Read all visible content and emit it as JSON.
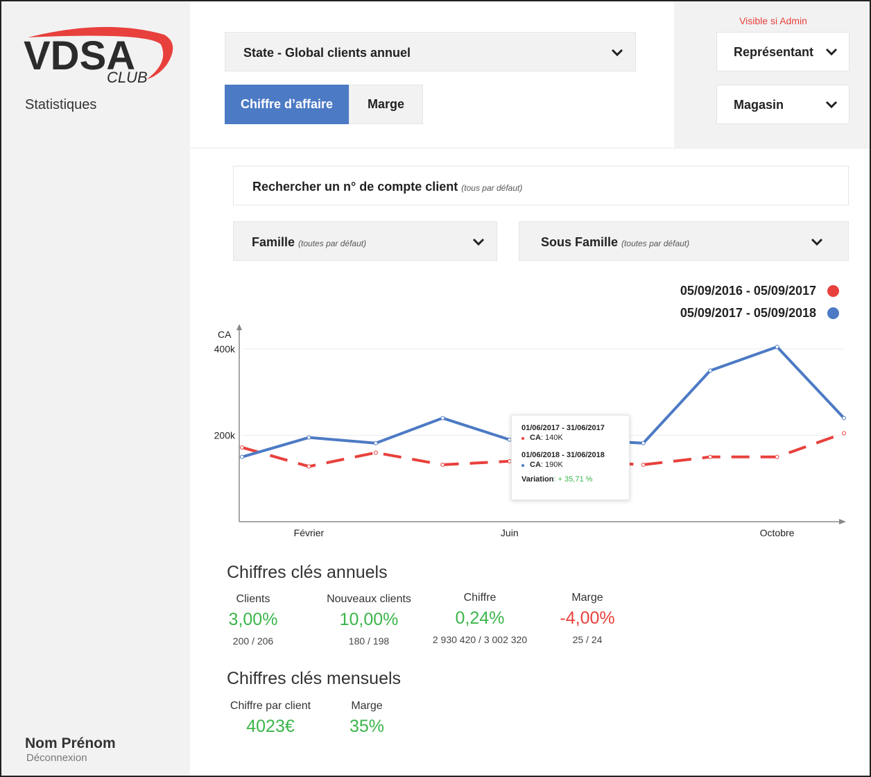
{
  "app": {
    "logo_text": "VDSA",
    "logo_subtext": "CLUB",
    "section_title": "Statistiques"
  },
  "user": {
    "name": "Nom Prénom",
    "logout_label": "Déconnexion"
  },
  "admin": {
    "visibility_note": "Visible si Admin",
    "representative_label": "Représentant",
    "store_label": "Magasin"
  },
  "report_select": {
    "value": "State - Global clients annuel"
  },
  "tabs": [
    {
      "label": "Chiffre d’affaire",
      "active": true
    },
    {
      "label": "Marge",
      "active": false
    }
  ],
  "search": {
    "label": "Rechercher un n° de compte client",
    "hint": "(tous par défaut)"
  },
  "filters": {
    "family": {
      "label": "Famille",
      "hint": "(toutes par défaut)"
    },
    "subfamily": {
      "label": "Sous Famille",
      "hint": "(toutes par défaut)"
    }
  },
  "colors": {
    "accent_blue": "#4c7ac4",
    "series_red": "#e8403c",
    "positive_green": "#3bb54a"
  },
  "chart_data": {
    "type": "line",
    "ylabel": "CA",
    "ylim": [
      0,
      450000
    ],
    "y_ticks": [
      {
        "value": 200000,
        "label": "200k"
      },
      {
        "value": 400000,
        "label": "400k"
      }
    ],
    "x_ticks": [
      {
        "index": 1,
        "label": "Février"
      },
      {
        "index": 4,
        "label": "Juin"
      },
      {
        "index": 8,
        "label": "Octobre"
      }
    ],
    "x_count": 10,
    "legend_position": "top-right",
    "series": [
      {
        "name": "05/09/2016 - 05/09/2017",
        "color": "#e8403c",
        "style": "dashed",
        "values": [
          172000,
          128000,
          160000,
          132000,
          140000,
          140000,
          132000,
          150000,
          150000,
          205000
        ]
      },
      {
        "name": "05/09/2017 - 05/09/2018",
        "color": "#4c7ac4",
        "style": "solid",
        "values": [
          150000,
          195000,
          182000,
          240000,
          190000,
          190000,
          182000,
          350000,
          405000,
          240000
        ]
      }
    ]
  },
  "tooltip": {
    "range1": "01/06/2017 - 31/06/2017",
    "ca1_label": "CA",
    "ca1_value": ": 140K",
    "range2": "01/06/2018 - 31/06/2018",
    "ca2_label": "CA",
    "ca2_value": ": 190K",
    "variation_label": "Variation",
    "variation_value": ": + 35,71 %"
  },
  "kpi_annual": {
    "title": "Chiffres clés annuels",
    "items": [
      {
        "label": "Clients",
        "value": "3,00%",
        "sub": "200 / 206",
        "trend": "positive"
      },
      {
        "label": "Nouveaux clients",
        "value": "10,00%",
        "sub": "180 / 198",
        "trend": "positive"
      },
      {
        "label": "Chiffre",
        "value": "0,24%",
        "sub": "2 930 420 / 3 002 320",
        "trend": "positive"
      },
      {
        "label": "Marge",
        "value": "-4,00%",
        "sub": "25 /  24",
        "trend": "negative"
      }
    ]
  },
  "kpi_monthly": {
    "title": "Chiffres clés mensuels",
    "items": [
      {
        "label": "Chiffre par client",
        "value": "4023€"
      },
      {
        "label": "Marge",
        "value": "35%"
      }
    ]
  }
}
